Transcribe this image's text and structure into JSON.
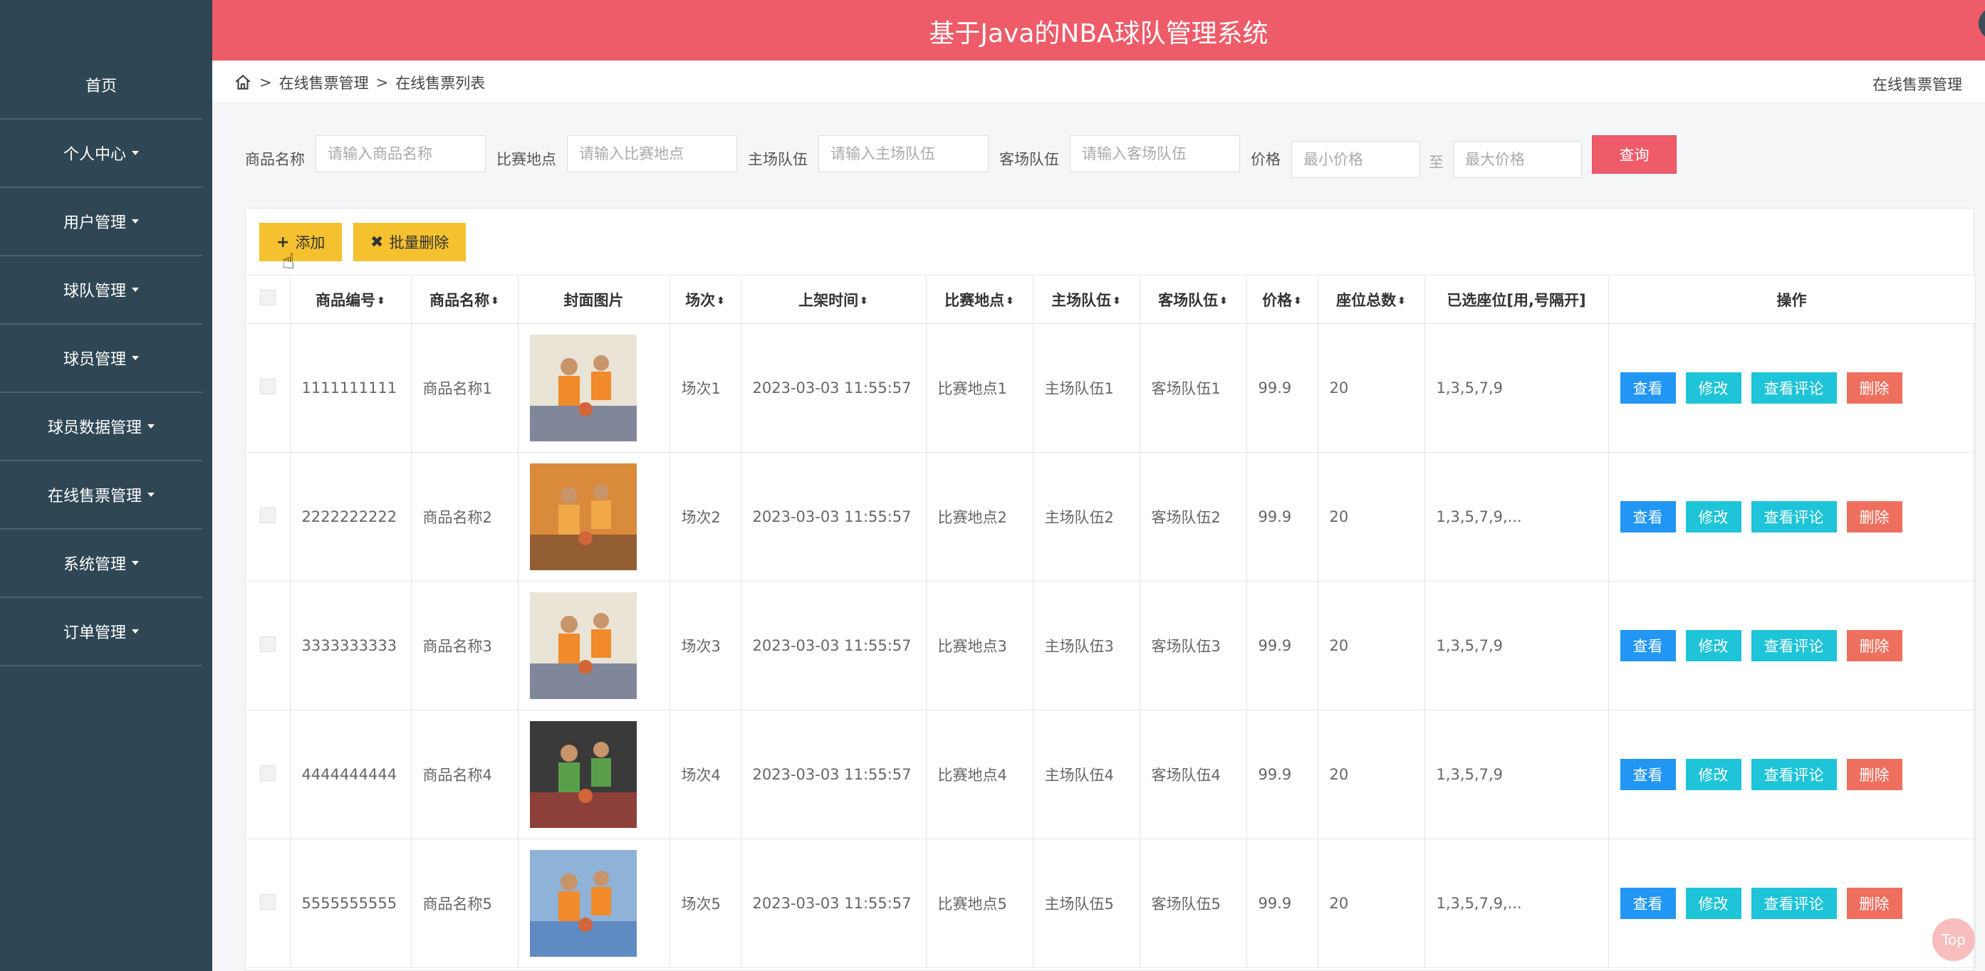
{
  "app": {
    "title": "基于Java的NBA球队管理系统"
  },
  "sidebar": {
    "items": [
      {
        "label": "首页",
        "has_caret": false
      },
      {
        "label": "个人中心",
        "has_caret": true
      },
      {
        "label": "用户管理",
        "has_caret": true
      },
      {
        "label": "球队管理",
        "has_caret": true
      },
      {
        "label": "球员管理",
        "has_caret": true
      },
      {
        "label": "球员数据管理",
        "has_caret": true
      },
      {
        "label": "在线售票管理",
        "has_caret": true
      },
      {
        "label": "系统管理",
        "has_caret": true
      },
      {
        "label": "订单管理",
        "has_caret": true
      }
    ]
  },
  "header": {
    "icons": [
      "expand-icon",
      "user-icon"
    ],
    "accent": "#ee5b69"
  },
  "breadcrumb": {
    "items": [
      "在线售票管理",
      "在线售票列表"
    ],
    "right": "在线售票管理"
  },
  "search": {
    "name_label": "商品名称",
    "name_placeholder": "请输入商品名称",
    "place_label": "比赛地点",
    "place_placeholder": "请输入比赛地点",
    "home_label": "主场队伍",
    "home_placeholder": "请输入主场队伍",
    "away_label": "客场队伍",
    "away_placeholder": "请输入客场队伍",
    "price_label": "价格",
    "min_placeholder": "最小价格",
    "to": "至",
    "max_placeholder": "最大价格",
    "query": "查询"
  },
  "toolbar": {
    "add": "添加",
    "batch_delete": "批量删除"
  },
  "table": {
    "headers": [
      "商品编号",
      "商品名称",
      "封面图片",
      "场次",
      "上架时间",
      "比赛地点",
      "主场队伍",
      "客场队伍",
      "价格",
      "座位总数",
      "已选座位[用,号隔开]",
      "操作"
    ],
    "actions": {
      "view": "查看",
      "edit": "修改",
      "comments": "查看评论",
      "delete": "删除"
    },
    "rows": [
      {
        "id": "1111111111",
        "name": "商品名称1",
        "session": "场次1",
        "time": "2023-03-03 11:55:57",
        "place": "比赛地点1",
        "home": "主场队伍1",
        "away": "客场队伍1",
        "price": "99.9",
        "seats": "20",
        "selected": "1,3,5,7,9"
      },
      {
        "id": "2222222222",
        "name": "商品名称2",
        "session": "场次2",
        "time": "2023-03-03 11:55:57",
        "place": "比赛地点2",
        "home": "主场队伍2",
        "away": "客场队伍2",
        "price": "99.9",
        "seats": "20",
        "selected": "1,3,5,7,9,..."
      },
      {
        "id": "3333333333",
        "name": "商品名称3",
        "session": "场次3",
        "time": "2023-03-03 11:55:57",
        "place": "比赛地点3",
        "home": "主场队伍3",
        "away": "客场队伍3",
        "price": "99.9",
        "seats": "20",
        "selected": "1,3,5,7,9"
      },
      {
        "id": "4444444444",
        "name": "商品名称4",
        "session": "场次4",
        "time": "2023-03-03 11:55:57",
        "place": "比赛地点4",
        "home": "主场队伍4",
        "away": "客场队伍4",
        "price": "99.9",
        "seats": "20",
        "selected": "1,3,5,7,9"
      },
      {
        "id": "5555555555",
        "name": "商品名称5",
        "session": "场次5",
        "time": "2023-03-03 11:55:57",
        "place": "比赛地点5",
        "home": "主场队伍5",
        "away": "客场队伍5",
        "price": "99.9",
        "seats": "20",
        "selected": "1,3,5,7,9,..."
      }
    ]
  },
  "back_to_top": "Top"
}
